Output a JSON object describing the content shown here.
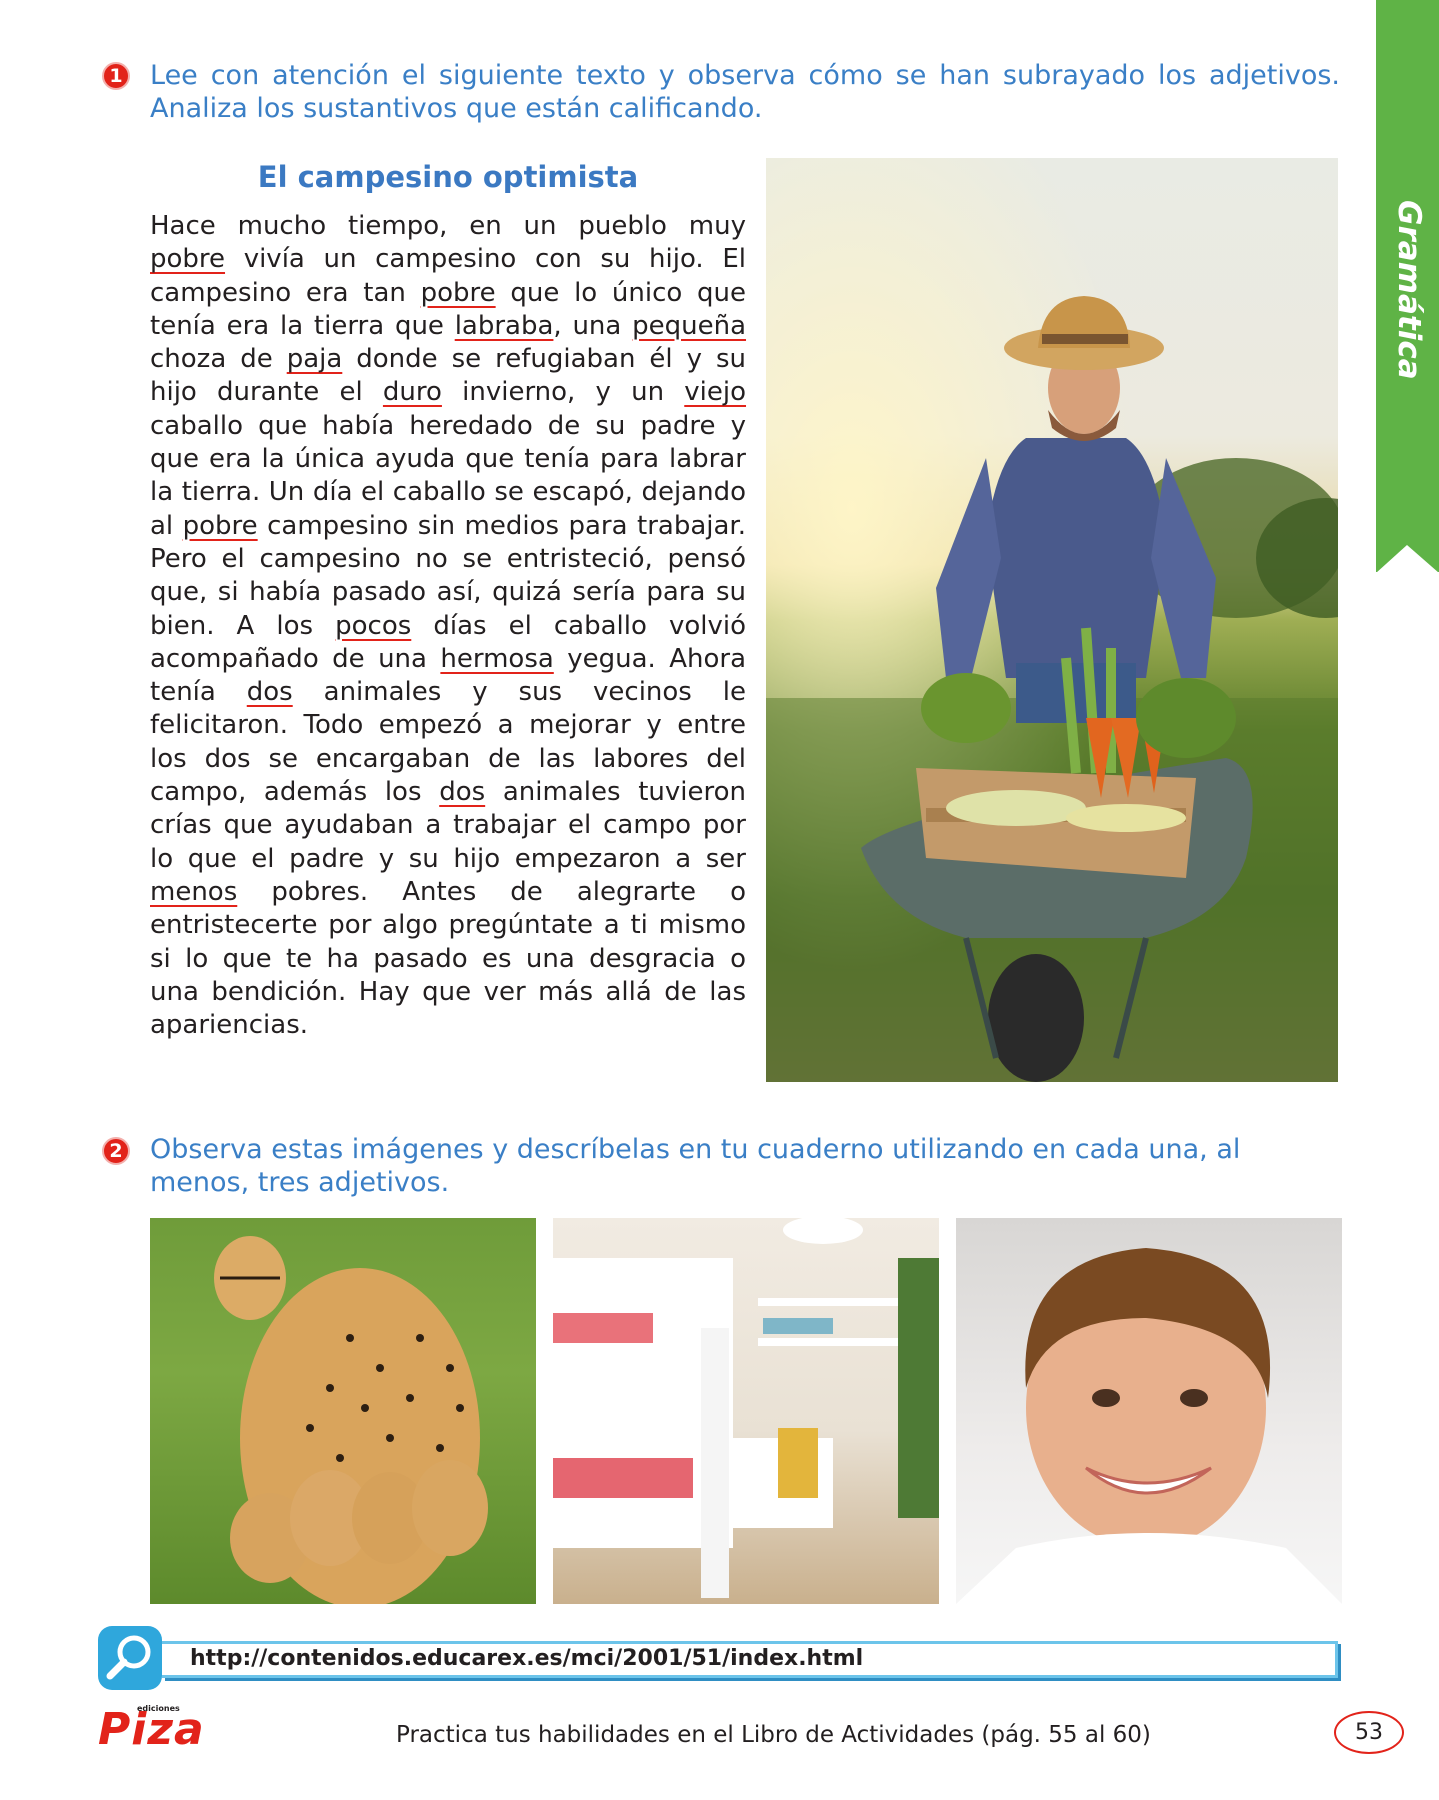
{
  "side_tab": {
    "label": "Gramática",
    "color": "#5fb346"
  },
  "activity1": {
    "number": "1",
    "instruction": "Lee con atención el siguiente texto y observa cómo se han subrayado los adjetivos. Analiza los sustantivos que están calificando."
  },
  "story": {
    "title": "El campesino optimista",
    "segments": [
      {
        "text": "Hace mucho tiempo, en un pueblo muy ",
        "u": false
      },
      {
        "text": "pobre",
        "u": true
      },
      {
        "text": " vivía un campesino con su hijo. El campesino era tan ",
        "u": false
      },
      {
        "text": "pobre",
        "u": true
      },
      {
        "text": " que lo único que tenía era la tierra que ",
        "u": false
      },
      {
        "text": "labraba",
        "u": true
      },
      {
        "text": ", una ",
        "u": false
      },
      {
        "text": "pequeña",
        "u": true
      },
      {
        "text": " choza de ",
        "u": false
      },
      {
        "text": "paja",
        "u": true
      },
      {
        "text": " donde se refugiaban él y su hijo durante el ",
        "u": false
      },
      {
        "text": "duro",
        "u": true
      },
      {
        "text": " invierno, y un ",
        "u": false
      },
      {
        "text": "viejo",
        "u": true
      },
      {
        "text": " caballo que había heredado de su padre y que era la única ayuda que tenía para labrar la tierra. Un día el caballo se escapó, dejando al ",
        "u": false
      },
      {
        "text": "pobre",
        "u": true
      },
      {
        "text": " campesino sin medios para trabajar. Pero el campesino no se entristeció, pensó que, si había pasado así, quizá sería para su bien. A los ",
        "u": false
      },
      {
        "text": "pocos",
        "u": true
      },
      {
        "text": " días el caballo volvió acompañado de una ",
        "u": false
      },
      {
        "text": "hermosa",
        "u": true
      },
      {
        "text": " yegua. Ahora tenía ",
        "u": false
      },
      {
        "text": "dos",
        "u": true
      },
      {
        "text": " animales y sus vecinos le felicitaron. Todo empezó a mejorar y entre los dos se encargaban de las labores del campo, además los ",
        "u": false
      },
      {
        "text": "dos",
        "u": true
      },
      {
        "text": " animales tuvieron crías que ayudaban a trabajar el campo por lo que el padre y su hijo empezaron a ser ",
        "u": false
      },
      {
        "text": "menos",
        "u": true
      },
      {
        "text": " pobres. Antes de alegrarte o entristecerte por algo pregúntate a ti mismo si lo que te ha pasado es una desgracia o una bendición. Hay que ver más allá de las apariencias.",
        "u": false
      }
    ]
  },
  "activity2": {
    "number": "2",
    "instruction": "Observa estas imágenes  y descríbelas en tu cuaderno utilizando en cada una, al menos, tres adjetivos."
  },
  "search": {
    "url": "http://contenidos.educarex.es/mci/2001/51/index.html",
    "icon": "magnifier-icon"
  },
  "footer": {
    "brand_small": "ediciones",
    "brand": "Piza",
    "practice_text": "Practica tus habilidades en el Libro de Actividades (pág. 55 al 60)",
    "page_number": "53"
  },
  "colors": {
    "accent_blue": "#3a7fc6",
    "accent_red": "#e2231a",
    "accent_green": "#5fb346"
  }
}
